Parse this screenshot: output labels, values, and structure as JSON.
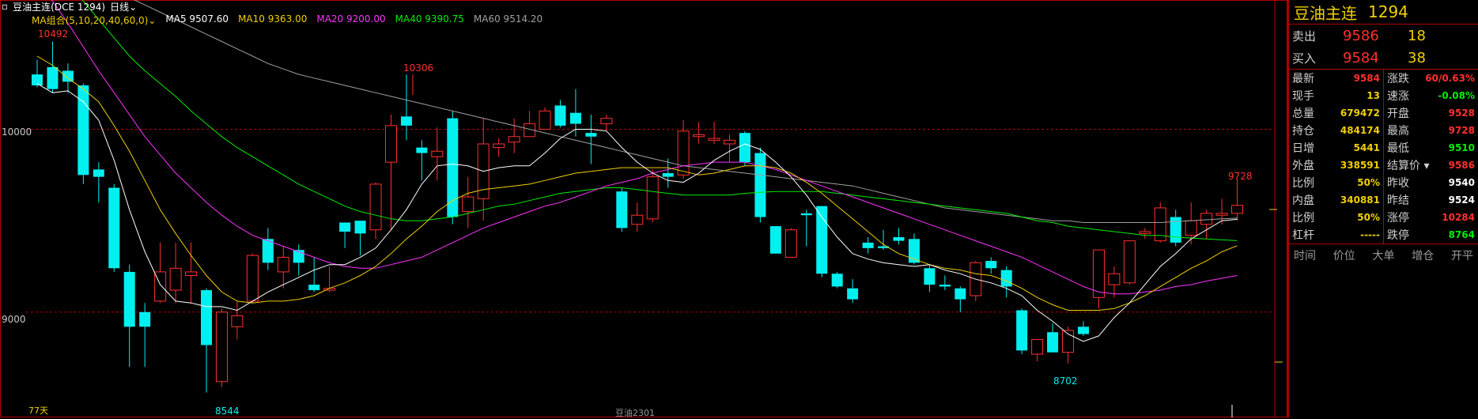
{
  "header": {
    "symbol_title": "豆油主连(DCE 1294)",
    "period": "日线",
    "period_caret": "⌄"
  },
  "ma": {
    "group_label": "MA组合(5,10,20,40,60,0)",
    "group_caret": "⌄",
    "items": [
      {
        "text": "MA5 9507.60",
        "color": "#ffffff"
      },
      {
        "text": "MA10 9363.00",
        "color": "#f0d000"
      },
      {
        "text": "MA20 9200.00",
        "color": "#ff33ff"
      },
      {
        "text": "MA40 9390.75",
        "color": "#00ee00"
      },
      {
        "text": "MA60 9514.20",
        "color": "#a0a0a0"
      }
    ]
  },
  "axis": {
    "labels": [
      "10000",
      "9000"
    ],
    "values": [
      10000,
      9000
    ]
  },
  "markers": {
    "high_left": "10492",
    "high_mid": "10306",
    "low_left": "8544",
    "low_right": "8702",
    "last_high": "9728"
  },
  "footer": {
    "days": "77天",
    "contract": "豆油2301"
  },
  "colors": {
    "up": "#ff3030",
    "down": "#00f0f0",
    "ma5": "#ffffff",
    "ma10": "#f0d000",
    "ma20": "#ff33ff",
    "ma40": "#00ee00",
    "ma60": "#a0a0a0",
    "grid": "#b00000"
  },
  "chart_data": {
    "type": "candlestick",
    "ylim": [
      8450,
      10560
    ],
    "candles": [
      [
        10300,
        10380,
        10230,
        10240
      ],
      [
        10340,
        10480,
        10200,
        10220
      ],
      [
        10320,
        10360,
        10200,
        10260
      ],
      [
        10240,
        10250,
        9700,
        9750
      ],
      [
        9780,
        9820,
        9600,
        9740
      ],
      [
        9680,
        9700,
        9220,
        9240
      ],
      [
        9220,
        9260,
        8700,
        8920
      ],
      [
        9000,
        9050,
        8700,
        8920
      ],
      [
        9060,
        9380,
        9050,
        9220
      ],
      [
        9120,
        9380,
        9050,
        9240
      ],
      [
        9200,
        9380,
        9050,
        9220
      ],
      [
        9120,
        9130,
        8560,
        8820
      ],
      [
        8620,
        9020,
        8590,
        9000
      ],
      [
        8920,
        9060,
        8850,
        8980
      ],
      [
        9060,
        9320,
        9050,
        9310
      ],
      [
        9400,
        9460,
        9230,
        9270
      ],
      [
        9220,
        9360,
        9130,
        9300
      ],
      [
        9340,
        9370,
        9200,
        9270
      ],
      [
        9150,
        9300,
        9110,
        9120
      ],
      [
        9120,
        9250,
        9110,
        9130
      ],
      [
        9490,
        9490,
        9350,
        9440
      ],
      [
        9500,
        9500,
        9310,
        9430
      ],
      [
        9450,
        9710,
        9400,
        9700
      ],
      [
        9820,
        10080,
        9450,
        10020
      ],
      [
        10070,
        10300,
        9940,
        10020
      ],
      [
        9900,
        9940,
        9720,
        9870
      ],
      [
        9850,
        10010,
        9720,
        9880
      ],
      [
        10060,
        10100,
        9480,
        9520
      ],
      [
        9550,
        9740,
        9460,
        9630
      ],
      [
        9620,
        10060,
        9500,
        9920
      ],
      [
        9900,
        9950,
        9850,
        9920
      ],
      [
        9930,
        10060,
        9870,
        9960
      ],
      [
        9960,
        10100,
        9980,
        10030
      ],
      [
        10000,
        10120,
        10030,
        10100
      ],
      [
        10130,
        10160,
        10010,
        10020
      ],
      [
        10090,
        10220,
        9960,
        10030
      ],
      [
        9980,
        10080,
        9810,
        9960
      ],
      [
        10030,
        10080,
        9990,
        10060
      ],
      [
        9660,
        9680,
        9440,
        9460
      ],
      [
        9480,
        9600,
        9440,
        9530
      ],
      [
        9510,
        9780,
        9490,
        9740
      ],
      [
        9760,
        9840,
        9680,
        9740
      ],
      [
        9750,
        10050,
        9730,
        9990
      ],
      [
        9960,
        10040,
        9920,
        9970
      ],
      [
        9940,
        10040,
        9920,
        9950
      ],
      [
        9920,
        9970,
        9820,
        9940
      ],
      [
        9980,
        9990,
        9800,
        9820
      ],
      [
        9870,
        9900,
        9490,
        9520
      ],
      [
        9470,
        9470,
        9320,
        9320
      ],
      [
        9300,
        9460,
        9300,
        9450
      ],
      [
        9540,
        9560,
        9360,
        9530
      ],
      [
        9580,
        9580,
        9190,
        9210
      ],
      [
        9210,
        9220,
        9130,
        9140
      ],
      [
        9130,
        9180,
        9050,
        9070
      ],
      [
        9380,
        9410,
        9320,
        9350
      ],
      [
        9360,
        9450,
        9340,
        9350
      ],
      [
        9410,
        9460,
        9370,
        9390
      ],
      [
        9400,
        9430,
        9260,
        9270
      ],
      [
        9240,
        9260,
        9110,
        9150
      ],
      [
        9150,
        9200,
        9120,
        9140
      ],
      [
        9130,
        9140,
        9000,
        9070
      ],
      [
        9090,
        9280,
        9060,
        9270
      ],
      [
        9280,
        9300,
        9210,
        9240
      ],
      [
        9230,
        9250,
        9080,
        9140
      ],
      [
        9010,
        9020,
        8770,
        8790
      ],
      [
        8770,
        8830,
        8730,
        8850
      ],
      [
        8890,
        8940,
        8780,
        8780
      ],
      [
        8780,
        8920,
        8720,
        8900
      ],
      [
        8920,
        8950,
        8870,
        8880
      ],
      [
        9080,
        9120,
        9020,
        9340
      ],
      [
        9150,
        9250,
        9080,
        9210
      ],
      [
        9160,
        9380,
        9150,
        9390
      ],
      [
        9430,
        9460,
        9400,
        9440
      ],
      [
        9390,
        9600,
        9380,
        9570
      ],
      [
        9520,
        9560,
        9360,
        9380
      ],
      [
        9420,
        9600,
        9370,
        9500
      ],
      [
        9480,
        9560,
        9400,
        9540
      ],
      [
        9530,
        9620,
        9480,
        9540
      ],
      [
        9540,
        9728,
        9500,
        9584
      ]
    ],
    "ma5": [
      10250,
      10200,
      10210,
      10150,
      10050,
      9830,
      9560,
      9330,
      9150,
      9060,
      9050,
      9030,
      9030,
      9010,
      9060,
      9110,
      9150,
      9190,
      9230,
      9260,
      9260,
      9300,
      9350,
      9450,
      9560,
      9700,
      9800,
      9810,
      9800,
      9770,
      9790,
      9800,
      9800,
      9870,
      9950,
      10000,
      10000,
      9990,
      9900,
      9820,
      9760,
      9720,
      9710,
      9760,
      9830,
      9880,
      9920,
      9890,
      9820,
      9740,
      9640,
      9520,
      9410,
      9320,
      9290,
      9270,
      9260,
      9250,
      9260,
      9230,
      9210,
      9180,
      9160,
      9130,
      9090,
      9010,
      8950,
      8880,
      8840,
      8870,
      8970,
      9050,
      9150,
      9250,
      9320,
      9400,
      9450,
      9500,
      9507.6
    ],
    "ma10": [
      10400,
      10350,
      10280,
      10220,
      10150,
      10020,
      9880,
      9720,
      9560,
      9430,
      9310,
      9200,
      9110,
      9060,
      9050,
      9060,
      9060,
      9070,
      9090,
      9130,
      9160,
      9200,
      9250,
      9320,
      9400,
      9470,
      9550,
      9610,
      9650,
      9670,
      9680,
      9690,
      9700,
      9720,
      9740,
      9760,
      9770,
      9780,
      9790,
      9790,
      9790,
      9790,
      9770,
      9750,
      9760,
      9780,
      9800,
      9800,
      9790,
      9760,
      9710,
      9650,
      9580,
      9510,
      9440,
      9370,
      9320,
      9290,
      9260,
      9240,
      9230,
      9210,
      9200,
      9170,
      9130,
      9080,
      9040,
      9010,
      9010,
      9010,
      9020,
      9050,
      9090,
      9140,
      9190,
      9240,
      9280,
      9330,
      9363
    ],
    "ma20": [
      10800,
      10700,
      10580,
      10450,
      10320,
      10200,
      10080,
      9960,
      9860,
      9760,
      9680,
      9600,
      9530,
      9470,
      9420,
      9390,
      9360,
      9330,
      9300,
      9270,
      9250,
      9240,
      9240,
      9260,
      9280,
      9300,
      9340,
      9380,
      9420,
      9460,
      9490,
      9520,
      9550,
      9580,
      9600,
      9630,
      9660,
      9690,
      9710,
      9730,
      9760,
      9780,
      9800,
      9810,
      9820,
      9820,
      9820,
      9800,
      9780,
      9750,
      9720,
      9690,
      9660,
      9630,
      9600,
      9570,
      9540,
      9510,
      9480,
      9450,
      9420,
      9390,
      9360,
      9330,
      9300,
      9260,
      9220,
      9180,
      9140,
      9110,
      9100,
      9100,
      9110,
      9120,
      9140,
      9150,
      9170,
      9185,
      9200
    ],
    "ma40": [
      11000,
      10900,
      10800,
      10700,
      10600,
      10500,
      10400,
      10320,
      10250,
      10180,
      10100,
      10030,
      9960,
      9900,
      9850,
      9800,
      9750,
      9700,
      9660,
      9620,
      9580,
      9550,
      9530,
      9510,
      9500,
      9500,
      9510,
      9520,
      9540,
      9560,
      9580,
      9590,
      9610,
      9630,
      9650,
      9660,
      9670,
      9680,
      9680,
      9670,
      9660,
      9650,
      9640,
      9640,
      9640,
      9640,
      9650,
      9655,
      9660,
      9660,
      9660,
      9660,
      9650,
      9640,
      9630,
      9620,
      9610,
      9600,
      9590,
      9580,
      9570,
      9560,
      9550,
      9540,
      9520,
      9500,
      9490,
      9470,
      9460,
      9450,
      9440,
      9430,
      9420,
      9420,
      9410,
      9405,
      9400,
      9395,
      9390.75
    ],
    "ma60": [
      11200,
      11100,
      11000,
      10920,
      10840,
      10780,
      10720,
      10680,
      10640,
      10600,
      10560,
      10520,
      10480,
      10440,
      10400,
      10360,
      10330,
      10300,
      10280,
      10260,
      10240,
      10220,
      10200,
      10180,
      10160,
      10140,
      10120,
      10100,
      10080,
      10060,
      10040,
      10020,
      10000,
      9980,
      9960,
      9940,
      9920,
      9900,
      9880,
      9860,
      9840,
      9820,
      9800,
      9790,
      9780,
      9770,
      9760,
      9750,
      9740,
      9730,
      9720,
      9710,
      9700,
      9690,
      9670,
      9650,
      9630,
      9610,
      9590,
      9570,
      9560,
      9550,
      9540,
      9530,
      9520,
      9510,
      9500,
      9500,
      9490,
      9490,
      9490,
      9490,
      9490,
      9490,
      9495,
      9500,
      9505,
      9510,
      9514.2
    ]
  },
  "quote": {
    "name": "豆油主连",
    "code": "1294",
    "book": [
      {
        "label": "卖出",
        "price": "9586",
        "vol": "18"
      },
      {
        "label": "买入",
        "price": "9584",
        "vol": "38"
      }
    ],
    "left": [
      {
        "label": "最新",
        "value": "9584",
        "color": "#ff3030"
      },
      {
        "label": "现手",
        "value": "13",
        "color": "#f0d000"
      },
      {
        "label": "总量",
        "value": "679472",
        "color": "#f0d000"
      },
      {
        "label": "持仓",
        "value": "484174",
        "color": "#f0d000"
      },
      {
        "label": "日增",
        "value": "5441",
        "color": "#f0d000"
      },
      {
        "label": "外盘",
        "value": "338591",
        "color": "#f0d000"
      },
      {
        "label": "比例",
        "value": "50%",
        "color": "#f0d000"
      },
      {
        "label": "内盘",
        "value": "340881",
        "color": "#f0d000"
      },
      {
        "label": "比例",
        "value": "50%",
        "color": "#f0d000"
      },
      {
        "label": "杠杆",
        "value": "-----",
        "color": "#f0d000"
      }
    ],
    "right": [
      {
        "label": "涨跌",
        "value": "60/0.63%",
        "color": "#ff3030"
      },
      {
        "label": "速涨",
        "value": "-0.08%",
        "color": "#00ee00"
      },
      {
        "label": "开盘",
        "value": "9528",
        "color": "#ff3030"
      },
      {
        "label": "最高",
        "value": "9728",
        "color": "#ff3030"
      },
      {
        "label": "最低",
        "value": "9510",
        "color": "#00ee00"
      },
      {
        "label": "结算价 ▾",
        "value": "9586",
        "color": "#ff3030"
      },
      {
        "label": "昨收",
        "value": "9540",
        "color": "#ffffff"
      },
      {
        "label": "昨结",
        "value": "9524",
        "color": "#ffffff"
      },
      {
        "label": "涨停",
        "value": "10284",
        "color": "#ff3030"
      },
      {
        "label": "跌停",
        "value": "8764",
        "color": "#00ee00"
      }
    ],
    "tick_headers": [
      "时间",
      "价位",
      "大单",
      "增仓",
      "开平"
    ]
  }
}
